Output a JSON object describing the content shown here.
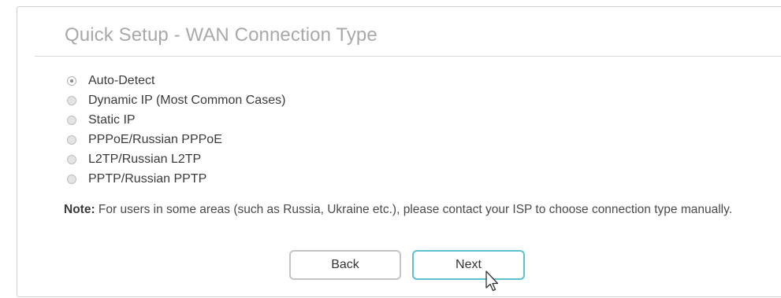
{
  "panel": {
    "title": "Quick Setup - WAN Connection Type"
  },
  "options": [
    {
      "label": "Auto-Detect",
      "selected": true
    },
    {
      "label": "Dynamic IP (Most Common Cases)",
      "selected": false
    },
    {
      "label": "Static IP",
      "selected": false
    },
    {
      "label": "PPPoE/Russian PPPoE",
      "selected": false
    },
    {
      "label": "L2TP/Russian L2TP",
      "selected": false
    },
    {
      "label": "PPTP/Russian PPTP",
      "selected": false
    }
  ],
  "note": {
    "label": "Note:",
    "text": " For users in some areas (such as Russia, Ukraine etc.), please contact your ISP to choose connection type manually."
  },
  "buttons": {
    "back_label": "Back",
    "next_label": "Next"
  },
  "colors": {
    "title": "#a9a9a9",
    "next_border": "#5cc0cf",
    "back_border": "#c4c4c4"
  }
}
